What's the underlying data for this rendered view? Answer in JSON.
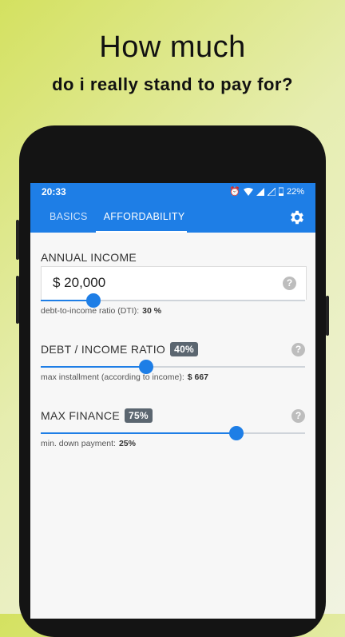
{
  "headline": {
    "line1": "How much",
    "line2": "do i really stand to pay for?"
  },
  "status_bar": {
    "time": "20:33",
    "battery": "22%",
    "icons": [
      "alarm-icon",
      "wifi-icon",
      "signal-icon",
      "signal-off-icon",
      "battery-icon"
    ]
  },
  "tabs": [
    {
      "label": "BASICS",
      "active": false
    },
    {
      "label": "AFFORDABILITY",
      "active": true
    }
  ],
  "colors": {
    "accent": "#1e7ee6",
    "badge": "#5b6670"
  },
  "annual_income": {
    "label": "ANNUAL INCOME",
    "value": "$ 20,000",
    "slider_fraction": 0.2,
    "note_label": "debt-to-income ratio (DTI):",
    "note_value": "30 %"
  },
  "dti": {
    "label": "DEBT / INCOME RATIO",
    "badge": "40%",
    "slider_fraction": 0.4,
    "note_label": "max installment (according to income):",
    "note_value": "$ 667"
  },
  "max_finance": {
    "label": "MAX FINANCE",
    "badge": "75%",
    "slider_fraction": 0.74,
    "note_label": "min. down payment:",
    "note_value": "25%"
  },
  "help_glyph": "?"
}
